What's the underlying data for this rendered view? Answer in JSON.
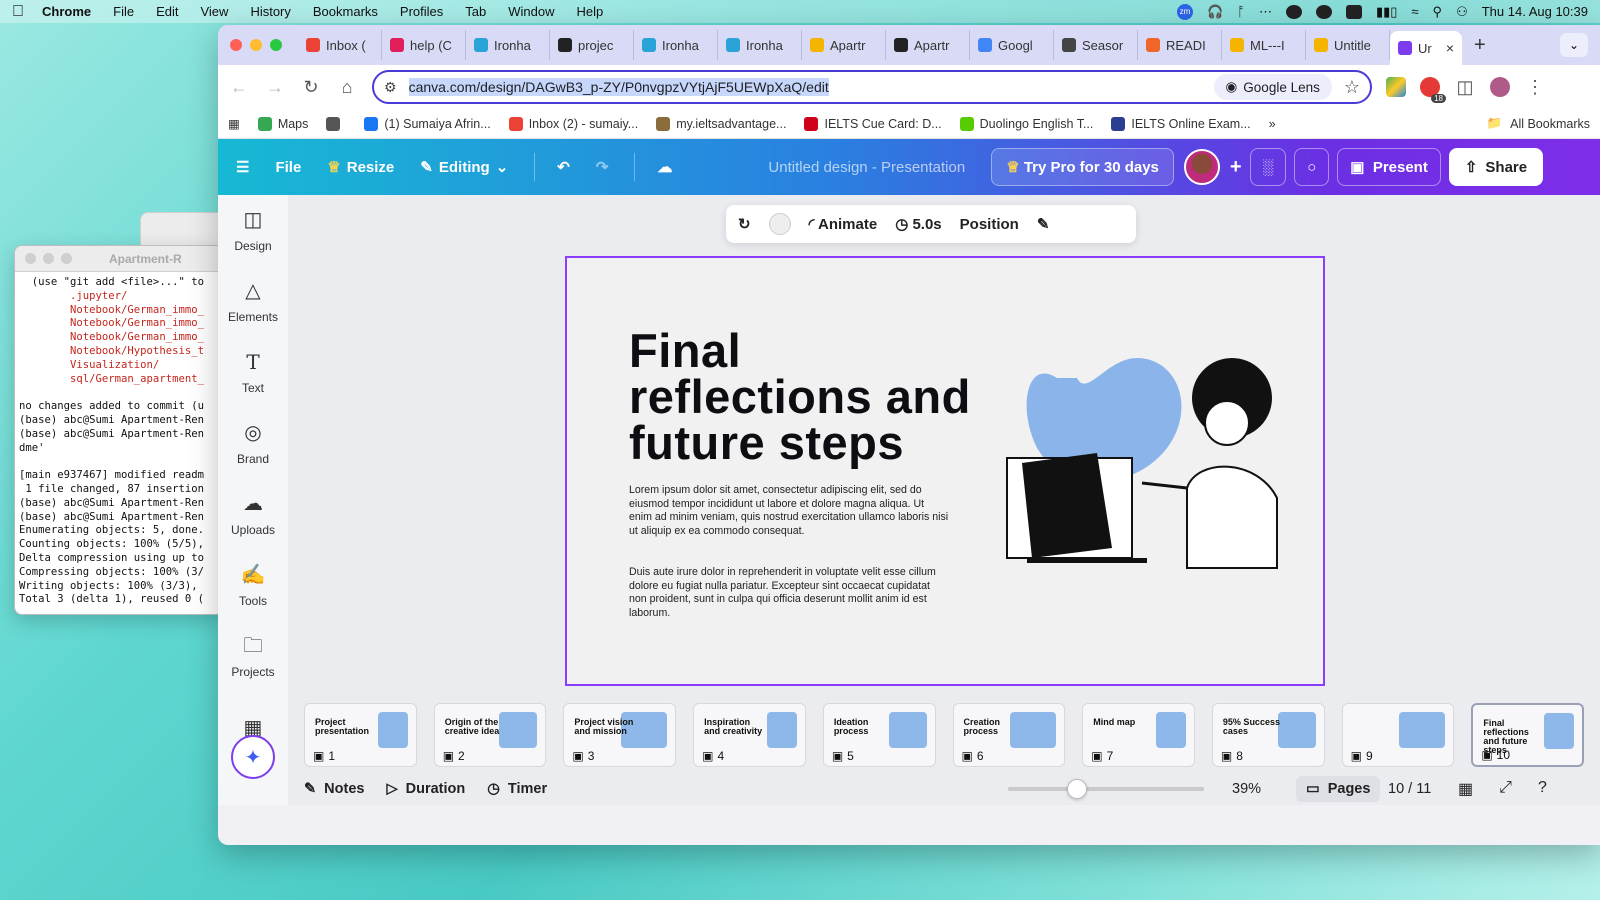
{
  "menubar": {
    "items": [
      "Chrome",
      "File",
      "Edit",
      "View",
      "History",
      "Bookmarks",
      "Profiles",
      "Tab",
      "Window",
      "Help"
    ],
    "clock": "Thu 14. Aug  10:39"
  },
  "terminal": {
    "title": "Apartment-R",
    "lines": [
      {
        "text": "  (use \"git add <file>...\" to",
        "red": false
      },
      {
        "text": "        .jupyter/",
        "red": true
      },
      {
        "text": "        Notebook/German_immo_",
        "red": true
      },
      {
        "text": "        Notebook/German_immo_",
        "red": true
      },
      {
        "text": "        Notebook/German_immo_",
        "red": true
      },
      {
        "text": "        Notebook/Hypothesis_t",
        "red": true
      },
      {
        "text": "        Visualization/",
        "red": true
      },
      {
        "text": "        sql/German_apartment_",
        "red": true
      },
      {
        "text": "",
        "red": false
      },
      {
        "text": "no changes added to commit (u",
        "red": false
      },
      {
        "text": "(base) abc@Sumi Apartment-Ren",
        "red": false
      },
      {
        "text": "(base) abc@Sumi Apartment-Ren",
        "red": false
      },
      {
        "text": "dme'",
        "red": false
      },
      {
        "text": "",
        "red": false
      },
      {
        "text": "[main e937467] modified readm",
        "red": false
      },
      {
        "text": " 1 file changed, 87 insertion",
        "red": false
      },
      {
        "text": "(base) abc@Sumi Apartment-Ren",
        "red": false
      },
      {
        "text": "(base) abc@Sumi Apartment-Ren",
        "red": false
      },
      {
        "text": "Enumerating objects: 5, done.",
        "red": false
      },
      {
        "text": "Counting objects: 100% (5/5),",
        "red": false
      },
      {
        "text": "Delta compression using up to",
        "red": false
      },
      {
        "text": "Compressing objects: 100% (3/",
        "red": false
      },
      {
        "text": "Writing objects: 100% (3/3),",
        "red": false
      },
      {
        "text": "Total 3 (delta 1), reused 0 (",
        "red": false
      }
    ]
  },
  "browser": {
    "tabs": [
      {
        "label": "Inbox (",
        "color": "#ea4335"
      },
      {
        "label": "help (C",
        "color": "#e01e5a"
      },
      {
        "label": "Ironha",
        "color": "#2aa4d8"
      },
      {
        "label": "projec",
        "color": "#222222"
      },
      {
        "label": "Ironha",
        "color": "#2aa4d8"
      },
      {
        "label": "Ironha",
        "color": "#2aa4d8"
      },
      {
        "label": "Apartr",
        "color": "#f4b400"
      },
      {
        "label": "Apartr",
        "color": "#222222"
      },
      {
        "label": "Googl",
        "color": "#4285f4"
      },
      {
        "label": "Seasor",
        "color": "#444444"
      },
      {
        "label": "READI",
        "color": "#f06529"
      },
      {
        "label": "ML---I",
        "color": "#f4b400"
      },
      {
        "label": "Untitle",
        "color": "#f4b400"
      }
    ],
    "active_tab": {
      "label": "Ur",
      "color": "#7d3cf0"
    },
    "url": "canva.com/design/DAGwB3_p-ZY/P0nvgpzVYtjAjF5UEWpXaQ/edit",
    "google_lens": "Google Lens",
    "ext_badge": "18",
    "bookmarks": [
      {
        "label": "Maps",
        "color": "#34a853"
      },
      {
        "label": "",
        "color": "#555555"
      },
      {
        "label": "(1) Sumaiya Afrin...",
        "color": "#1877f2"
      },
      {
        "label": "Inbox (2) - sumaiy...",
        "color": "#ea4335"
      },
      {
        "label": "my.ieltsadvantage...",
        "color": "#8a6d3b"
      },
      {
        "label": "IELTS Cue Card: D...",
        "color": "#d0021b"
      },
      {
        "label": "Duolingo English T...",
        "color": "#58cc02"
      },
      {
        "label": "IELTS Online Exam...",
        "color": "#2c3e91"
      }
    ],
    "all_bookmarks": "All Bookmarks"
  },
  "canva": {
    "file": "File",
    "resize": "Resize",
    "editing": "Editing",
    "design_title": "Untitled design - Presentation",
    "try_pro": "Try Pro for 30 days",
    "present": "Present",
    "share": "Share",
    "sidebar": [
      "Design",
      "Elements",
      "Text",
      "Brand",
      "Uploads",
      "Tools",
      "Projects"
    ],
    "context": {
      "animate": "Animate",
      "duration": "5.0s",
      "position": "Position"
    },
    "slide": {
      "title": "Final reflections and future steps",
      "para1": "Lorem ipsum dolor sit amet, consectetur adipiscing elit, sed do eiusmod tempor incididunt ut labore et dolore magna aliqua. Ut enim ad minim veniam, quis nostrud exercitation ullamco laboris nisi ut aliquip ex ea commodo consequat.",
      "para2": "Duis aute irure dolor in reprehenderit in voluptate velit esse cillum dolore eu fugiat nulla pariatur. Excepteur sint occaecat cupidatat non proident, sunt in culpa qui officia deserunt mollit anim id est laborum."
    },
    "pages": [
      {
        "num": "1",
        "title": "Project presentation"
      },
      {
        "num": "2",
        "title": "Origin of the creative idea"
      },
      {
        "num": "3",
        "title": "Project vision and mission"
      },
      {
        "num": "4",
        "title": "Inspiration and creativity"
      },
      {
        "num": "5",
        "title": "Ideation process"
      },
      {
        "num": "6",
        "title": "Creation process"
      },
      {
        "num": "7",
        "title": "Mind map"
      },
      {
        "num": "8",
        "title": "95% Success cases"
      },
      {
        "num": "9",
        "title": ""
      },
      {
        "num": "10",
        "title": "Final reflections and future steps"
      }
    ],
    "bottom": {
      "notes": "Notes",
      "duration": "Duration",
      "timer": "Timer",
      "zoom": "39%",
      "zoom_level": 0.39,
      "pages_btn": "Pages",
      "page_count": "10 / 11"
    },
    "accent": "#8b3dff"
  }
}
